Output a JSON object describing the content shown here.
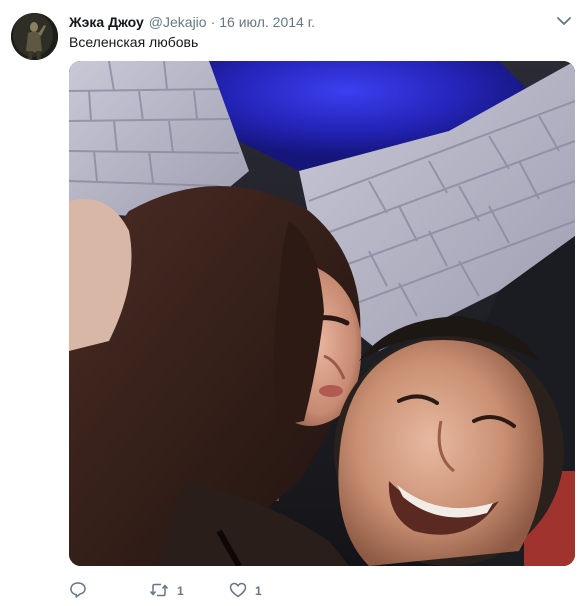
{
  "tweet": {
    "author_name": "Жэка Джоу",
    "handle": "@Jekajio",
    "separator": "·",
    "date": "16 июл. 2014 г.",
    "text": "Вселенская любовь",
    "media_icon": "photo",
    "actions": {
      "reply_icon": "reply-icon",
      "retweet_icon": "retweet-icon",
      "retweet_count": "1",
      "like_icon": "heart-icon",
      "like_count": "1"
    },
    "colors": {
      "text": "#14171a",
      "secondary": "#657786",
      "background": "#ffffff"
    }
  }
}
